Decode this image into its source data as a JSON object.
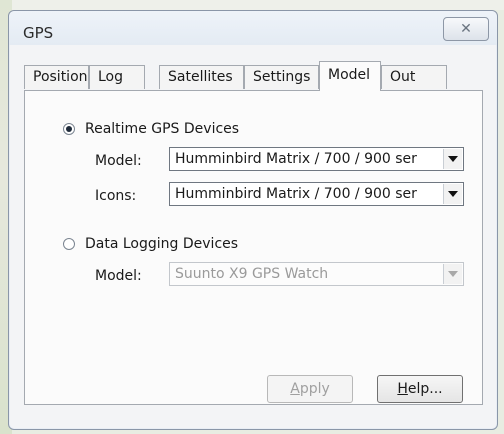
{
  "window": {
    "title": "GPS",
    "close_glyph": "✕"
  },
  "tabs": [
    {
      "label": "Position",
      "active": false
    },
    {
      "label": "Log",
      "active": false
    },
    {
      "label": "Satellites",
      "active": false
    },
    {
      "label": "Settings",
      "active": false
    },
    {
      "label": "Model",
      "active": true
    },
    {
      "label": "Out",
      "active": false
    }
  ],
  "realtime": {
    "radio_label": "Realtime GPS Devices",
    "checked": true,
    "model_label": "Model:",
    "model_value": "Humminbird Matrix / 700 / 900 ser",
    "icons_label": "Icons:",
    "icons_value": "Humminbird Matrix / 700 / 900 ser"
  },
  "datalogging": {
    "radio_label": "Data Logging Devices",
    "checked": false,
    "model_label": "Model:",
    "model_value": "Suunto X9 GPS Watch",
    "enabled": false
  },
  "buttons": {
    "apply_prefix": "",
    "apply_mnemonic": "A",
    "apply_rest": "pply",
    "apply_enabled": false,
    "help_prefix": "",
    "help_mnemonic": "H",
    "help_rest": "elp..."
  }
}
